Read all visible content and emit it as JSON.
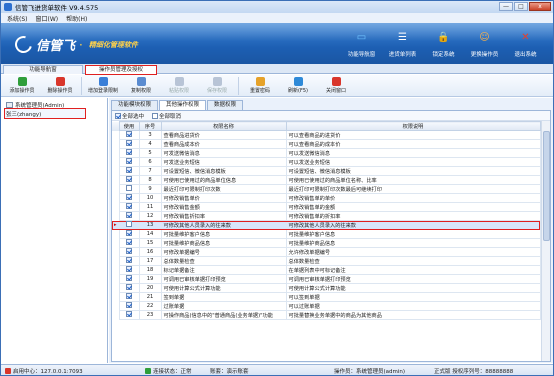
{
  "window": {
    "title": "信管飞进货单软件 V9.4.575",
    "min": "—",
    "max": "□",
    "close": "x"
  },
  "menu": [
    "系统(S)",
    "窗口(W)",
    "帮助(H)"
  ],
  "brand": {
    "name": "信管飞",
    "dot": "·",
    "slogan": "精细化管理软件"
  },
  "top_buttons": [
    {
      "label": "功能导航窗",
      "icon": "monitor-icon",
      "color": "#6fc3ff"
    },
    {
      "label": "进货单列表",
      "icon": "list-icon",
      "color": "#ffffff"
    },
    {
      "label": "锁定系统",
      "icon": "lock-icon",
      "color": "#ffcf4a"
    },
    {
      "label": "更换操作员",
      "icon": "user-icon",
      "color": "#ffb347"
    },
    {
      "label": "退出系统",
      "icon": "exit-icon",
      "color": "#e8402a"
    }
  ],
  "tabs": [
    {
      "label": "功能导航窗",
      "active": false
    },
    {
      "label": "操作员管理及授权",
      "active": true
    }
  ],
  "toolbar": [
    {
      "label": "添加操作员",
      "icon": "add-user-icon",
      "color": "#2f9e3a",
      "enabled": true
    },
    {
      "label": "删除操作员",
      "icon": "delete-user-icon",
      "color": "#d9362b",
      "enabled": true
    },
    {
      "label": "增加登录限制",
      "icon": "login-limit-icon",
      "color": "#3a7fd8",
      "enabled": true
    },
    {
      "label": "复制权限",
      "icon": "copy-icon",
      "color": "#5a8bd0",
      "enabled": true
    },
    {
      "label": "粘贴权限",
      "icon": "paste-icon",
      "color": "#b8c4d6",
      "enabled": false
    },
    {
      "label": "保存权限",
      "icon": "save-icon",
      "color": "#b8c4d6",
      "enabled": false
    },
    {
      "label": "重置密码",
      "icon": "key-icon",
      "color": "#e6a22a",
      "enabled": true
    },
    {
      "label": "刷新(F5)",
      "icon": "refresh-icon",
      "color": "#2f8ad8",
      "enabled": true
    },
    {
      "label": "关闭窗口",
      "icon": "close-window-icon",
      "color": "#d9362b",
      "enabled": true
    }
  ],
  "tree": [
    {
      "label": "系统管理员(Admin)",
      "selected": false
    },
    {
      "label": "张三(zhangy)",
      "selected": true
    }
  ],
  "subtabs": [
    {
      "label": "功能模块权限",
      "active": false
    },
    {
      "label": "其他操作权限",
      "active": true
    },
    {
      "label": "数据权限",
      "active": false
    }
  ],
  "select_all": "全部选中",
  "deselect_all": "全部取消",
  "columns": [
    "使用",
    "序号",
    "权限名称",
    "权限说明"
  ],
  "rows": [
    {
      "checked": true,
      "no": "3",
      "name": "查看商品进货价",
      "desc": "可以查看商品的进货价"
    },
    {
      "checked": true,
      "no": "4",
      "name": "查看商品成本价",
      "desc": "可以查看商品的成本价"
    },
    {
      "checked": true,
      "no": "5",
      "name": "可发送微信消息",
      "desc": "可以发送微信消息"
    },
    {
      "checked": true,
      "no": "6",
      "name": "可发送业务短信",
      "desc": "可以发送业务短信"
    },
    {
      "checked": true,
      "no": "7",
      "name": "可设置短信、微信消息模板",
      "desc": "可设置短信、微信消息模板"
    },
    {
      "checked": true,
      "no": "8",
      "name": "可使用已使用过的商品单位信息",
      "desc": "可使用已使用过的商品单位名称、比率"
    },
    {
      "checked": false,
      "no": "9",
      "name": "最近打印可限制打印次数",
      "desc": "最近打印可限制打印次数最后可继续打印"
    },
    {
      "checked": true,
      "no": "10",
      "name": "可修改销售单价",
      "desc": "可修改销售单的单价"
    },
    {
      "checked": true,
      "no": "11",
      "name": "可修改销售金额",
      "desc": "可修改销售单的金额"
    },
    {
      "checked": true,
      "no": "12",
      "name": "可修改销售折扣率",
      "desc": "可修改销售单的折扣率"
    },
    {
      "checked": false,
      "no": "13",
      "name": "可修改其他人员录入的往来款",
      "desc": "可修改其他人员录入的往来款",
      "highlight": true
    },
    {
      "checked": true,
      "no": "14",
      "name": "可批量维护客户信息",
      "desc": "可批量维护客户信息"
    },
    {
      "checked": true,
      "no": "15",
      "name": "可批量维护商品信息",
      "desc": "可批量维护商品信息"
    },
    {
      "checked": true,
      "no": "16",
      "name": "可修改单据编号",
      "desc": "允许修改单据编号"
    },
    {
      "checked": true,
      "no": "17",
      "name": "总体数量检查",
      "desc": "总体数量检查"
    },
    {
      "checked": true,
      "no": "18",
      "name": "标记单据备注",
      "desc": "在单据列表中可标记备注"
    },
    {
      "checked": true,
      "no": "19",
      "name": "可调用已审核单据打印预览",
      "desc": "可调用已审核单据打印预览"
    },
    {
      "checked": true,
      "no": "20",
      "name": "可使用计算公式计算功能",
      "desc": "可使用计算公式计算功能"
    },
    {
      "checked": true,
      "no": "21",
      "name": "签到单据",
      "desc": "可以签到单据"
    },
    {
      "checked": true,
      "no": "22",
      "name": "过账单据",
      "desc": "可以过账单据"
    },
    {
      "checked": true,
      "no": "23",
      "name": "可操作商品(信息中的\"普通商品(业务单据)\"功能",
      "desc": "可批量替换业务单据中的商品为其他商品"
    }
  ],
  "status": {
    "center": "启用中心：127.0.0.1:7093",
    "conn": "连接状态：正常",
    "dept": "账套：演示账套",
    "operator": "操作员：系统管理员(admin)",
    "version": "正式版 授权序列号：88888888"
  }
}
